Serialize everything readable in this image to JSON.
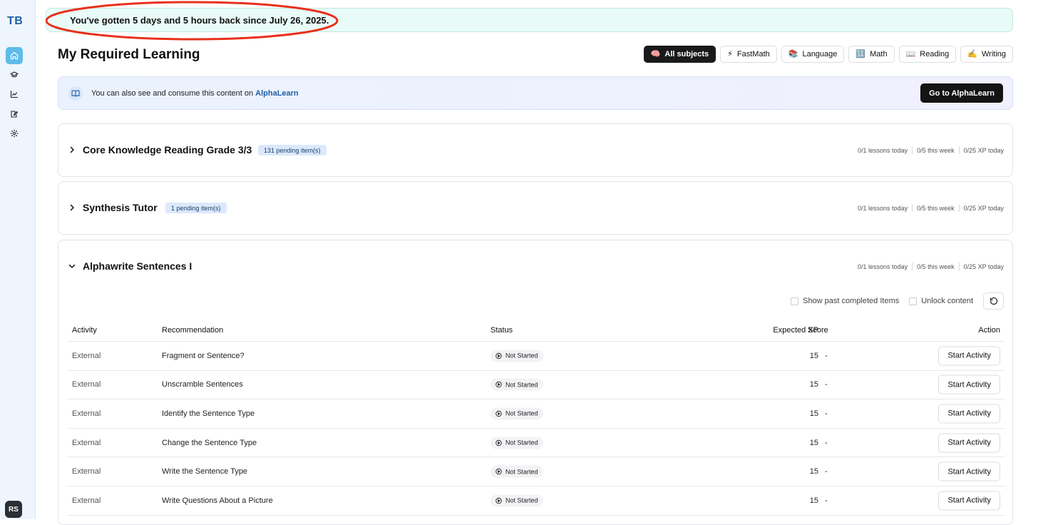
{
  "sidebar": {
    "logo": "TB",
    "avatar": "RS",
    "items": [
      {
        "icon": "home-icon",
        "active": true
      },
      {
        "icon": "graduation-cap-icon",
        "active": false
      },
      {
        "icon": "chart-icon",
        "active": false
      },
      {
        "icon": "edit-note-icon",
        "active": false
      },
      {
        "icon": "gear-icon",
        "active": false
      }
    ]
  },
  "banner": {
    "text": "You've gotten 5 days and 5 hours back since July 26, 2025.",
    "highlight_color": "#e8301c"
  },
  "page": {
    "title": "My Required Learning"
  },
  "filters": [
    {
      "emoji": "🧠",
      "label": "All subjects",
      "active": true
    },
    {
      "emoji": "⚡",
      "label": "FastMath",
      "active": false
    },
    {
      "emoji": "📚",
      "label": "Language",
      "active": false
    },
    {
      "emoji": "🔢",
      "label": "Math",
      "active": false
    },
    {
      "emoji": "📖",
      "label": "Reading",
      "active": false
    },
    {
      "emoji": "✍️",
      "label": "Writing",
      "active": false
    }
  ],
  "alpha": {
    "text": "You can also see and consume this content on ",
    "link": "AlphaLearn",
    "button": "Go to AlphaLearn"
  },
  "courses": [
    {
      "title": "Core Knowledge Reading Grade 3/3",
      "pending": "131 pending item(s)",
      "expanded": false,
      "stats": [
        "0/1 lessons today",
        "0/5 this week",
        "0/25 XP today"
      ]
    },
    {
      "title": "Synthesis Tutor",
      "pending": "1 pending item(s)",
      "expanded": false,
      "stats": [
        "0/1 lessons today",
        "0/5 this week",
        "0/25 XP today"
      ]
    },
    {
      "title": "Alphawrite Sentences I",
      "pending": "",
      "expanded": true,
      "stats": [
        "0/1 lessons today",
        "0/5 this week",
        "0/25 XP today"
      ]
    }
  ],
  "table": {
    "show_past_label": "Show past completed Items",
    "unlock_label": "Unlock content",
    "columns": [
      "Activity",
      "Recommendation",
      "Status",
      "Expected XP",
      "Score",
      "Action"
    ],
    "rows": [
      {
        "activity": "External",
        "recommendation": "Fragment or Sentence?",
        "status": "Not Started",
        "xp": "15",
        "score": "-",
        "action": "Start Activity"
      },
      {
        "activity": "External",
        "recommendation": "Unscramble Sentences",
        "status": "Not Started",
        "xp": "15",
        "score": "-",
        "action": "Start Activity"
      },
      {
        "activity": "External",
        "recommendation": "Identify the Sentence Type",
        "status": "Not Started",
        "xp": "15",
        "score": "-",
        "action": "Start Activity"
      },
      {
        "activity": "External",
        "recommendation": "Change the Sentence Type",
        "status": "Not Started",
        "xp": "15",
        "score": "-",
        "action": "Start Activity"
      },
      {
        "activity": "External",
        "recommendation": "Write the Sentence Type",
        "status": "Not Started",
        "xp": "15",
        "score": "-",
        "action": "Start Activity"
      },
      {
        "activity": "External",
        "recommendation": "Write Questions About a Picture",
        "status": "Not Started",
        "xp": "15",
        "score": "-",
        "action": "Start Activity"
      }
    ]
  }
}
